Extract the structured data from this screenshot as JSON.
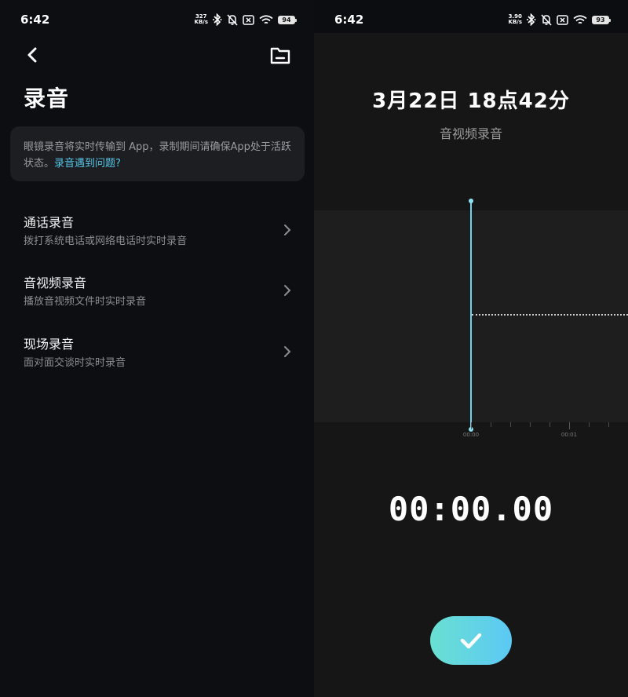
{
  "left_screen": {
    "status_bar": {
      "time": "6:42",
      "net_speed_value": "327",
      "net_speed_unit": "KB/s",
      "battery": "94"
    },
    "title": "录音",
    "notice": {
      "text": "眼镜录音将实时传输到 App，录制期间请确保App处于活跃状态。",
      "link": "录音遇到问题?"
    },
    "menu": [
      {
        "title": "通话录音",
        "subtitle": "拨打系统电话或网络电话时实时录音"
      },
      {
        "title": "音视频录音",
        "subtitle": "播放音视频文件时实时录音"
      },
      {
        "title": "现场录音",
        "subtitle": "面对面交谈时实时录音"
      }
    ],
    "icons": {
      "back": "back-arrow-icon",
      "folder": "folder-icon",
      "chevron": "chevron-right-icon"
    }
  },
  "right_screen": {
    "status_bar": {
      "time": "6:42",
      "net_speed_value": "3.90",
      "net_speed_unit": "KB/s",
      "battery": "93"
    },
    "recording_title": "3月22日 18点42分",
    "recording_type": "音视频录音",
    "timeline": {
      "labels": [
        "00:00",
        "00:01"
      ]
    },
    "timer": "00:00.00",
    "colors": {
      "accent": "#6fd3ec",
      "button_gradient_start": "#69e0d2",
      "button_gradient_end": "#5cc8f4"
    },
    "icons": {
      "confirm": "checkmark-icon"
    }
  }
}
